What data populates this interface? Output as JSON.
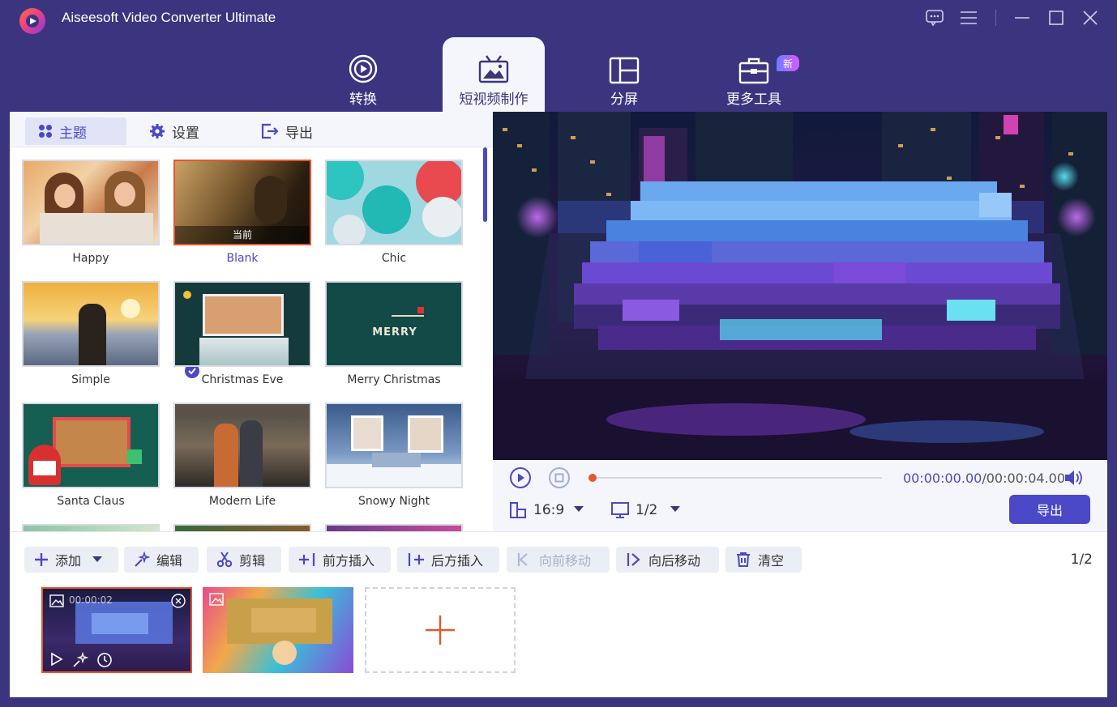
{
  "app": {
    "title": "Aiseesoft Video Converter Ultimate"
  },
  "window_controls": [
    "feedback-icon",
    "menu-icon",
    "minimize-icon",
    "maximize-icon",
    "close-icon"
  ],
  "nav": {
    "tabs": [
      {
        "label": "转换",
        "icon": "convert-icon"
      },
      {
        "label": "短视频制作",
        "icon": "mv-icon",
        "active": true
      },
      {
        "label": "分屏",
        "icon": "collage-icon"
      },
      {
        "label": "更多工具",
        "icon": "toolbox-icon"
      }
    ],
    "new_badge": "新"
  },
  "subtabs": [
    {
      "label": "主题",
      "active": true
    },
    {
      "label": "设置"
    },
    {
      "label": "导出"
    }
  ],
  "themes": [
    {
      "name": "Happy"
    },
    {
      "name": "Blank",
      "selected": true,
      "current_label": "当前"
    },
    {
      "name": "Chic"
    },
    {
      "name": "Simple"
    },
    {
      "name": "Christmas Eve"
    },
    {
      "name": "Merry Christmas"
    },
    {
      "name": "Santa Claus"
    },
    {
      "name": "Modern Life"
    },
    {
      "name": "Snowy Night"
    }
  ],
  "player": {
    "current_time": "00:00:00.00",
    "total_time": "/00:00:04.00",
    "aspect_ratio": "16:9",
    "screen_page": "1/2",
    "export_label": "导出",
    "progress": 0
  },
  "toolbar": {
    "add": "添加",
    "edit": "编辑",
    "trim": "剪辑",
    "insert_before": "前方插入",
    "insert_after": "后方插入",
    "move_forward": "向前移动",
    "move_backward": "向后移动",
    "clear": "清空",
    "page_count": "1/2"
  },
  "clips": [
    {
      "duration_overlay": "00:00:02",
      "selected": true
    },
    {
      "selected": false
    }
  ],
  "colors": {
    "accent": "#4b48c7",
    "titlebar": "#3b3580",
    "selected_border": "#e8552f"
  }
}
